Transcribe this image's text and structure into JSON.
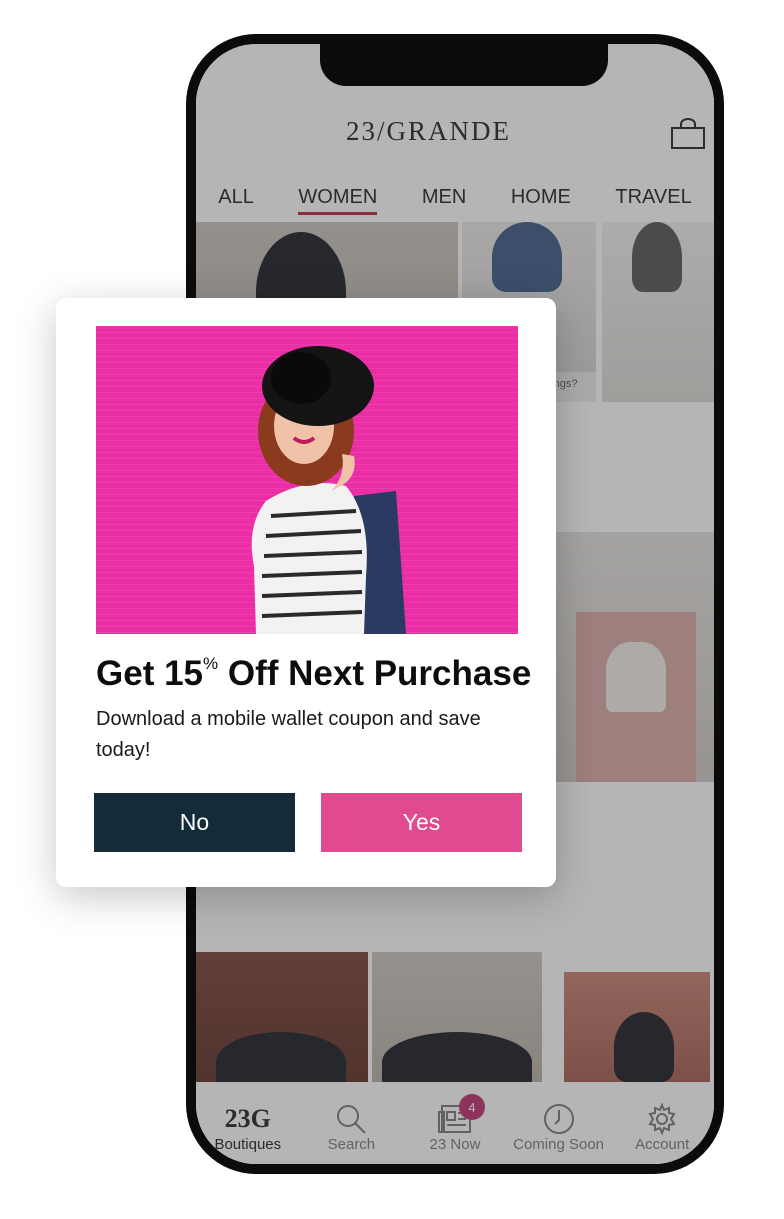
{
  "app": {
    "logo": "23/GRANDE"
  },
  "nav": [
    "ALL",
    "WOMEN",
    "MEN",
    "HOME",
    "TRAVEL"
  ],
  "active_nav": "WOMEN",
  "tabbar": {
    "items": [
      {
        "label": "Boutiques",
        "icon": "brand-23g-icon",
        "mark": "23G"
      },
      {
        "label": "Search",
        "icon": "search-icon"
      },
      {
        "label": "23 Now",
        "icon": "news-icon",
        "badge": "4"
      },
      {
        "label": "Coming Soon",
        "icon": "clock-icon"
      },
      {
        "label": "Account",
        "icon": "gear-icon"
      }
    ]
  },
  "content_snippet": "things?",
  "modal": {
    "headline_pre": "Get 15",
    "headline_sup": "%",
    "headline_post": " Off Next Purchase",
    "body": "Download a mobile wallet coupon and save today!",
    "no_label": "No",
    "yes_label": "Yes",
    "colors": {
      "hero_bg": "#ec2ea6",
      "no_bg": "#142b3a",
      "yes_bg": "#e04a8e"
    }
  }
}
